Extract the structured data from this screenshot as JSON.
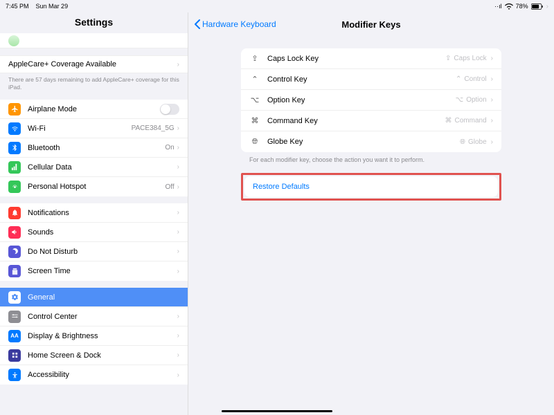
{
  "status": {
    "time": "7:45 PM",
    "date": "Sun Mar 29",
    "battery": "78%"
  },
  "sidebar": {
    "title": "Settings",
    "applecare": {
      "label": "AppleCare+ Coverage Available",
      "note": "There are 57 days remaining to add AppleCare+ coverage for this iPad."
    },
    "group1": {
      "airplane": "Airplane Mode",
      "wifi": "Wi-Fi",
      "wifi_val": "PACE384_5G",
      "bt": "Bluetooth",
      "bt_val": "On",
      "cell": "Cellular Data",
      "hotspot": "Personal Hotspot",
      "hotspot_val": "Off"
    },
    "group2": {
      "notif": "Notifications",
      "sounds": "Sounds",
      "dnd": "Do Not Disturb",
      "screentime": "Screen Time"
    },
    "group3": {
      "general": "General",
      "cc": "Control Center",
      "display": "Display & Brightness",
      "home": "Home Screen & Dock",
      "access": "Accessibility"
    }
  },
  "detail": {
    "back": "Hardware Keyboard",
    "title": "Modifier Keys",
    "rows": {
      "caps": {
        "label": "Caps Lock Key",
        "val": "Caps Lock"
      },
      "ctrl": {
        "label": "Control Key",
        "val": "Control"
      },
      "opt": {
        "label": "Option Key",
        "val": "Option"
      },
      "cmd": {
        "label": "Command Key",
        "val": "Command"
      },
      "globe": {
        "label": "Globe Key",
        "val": "Globe"
      }
    },
    "footer": "For each modifier key, choose the action you want it to perform.",
    "restore": "Restore Defaults"
  }
}
